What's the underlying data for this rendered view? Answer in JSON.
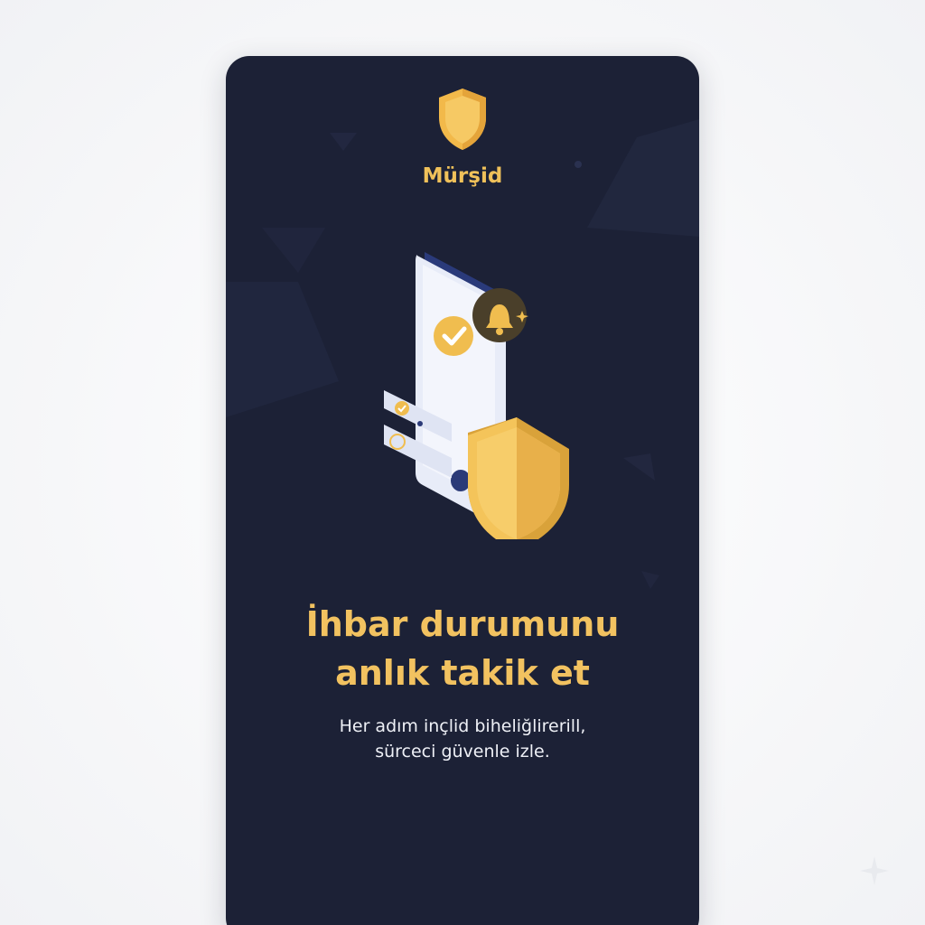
{
  "brand": {
    "name": "Mürşid",
    "icon": "shield-icon",
    "accent_color": "#f0c15a"
  },
  "illustration": {
    "icons": [
      "phone-icon",
      "shield-icon",
      "bell-icon",
      "checkmark-icon"
    ]
  },
  "content": {
    "headline_line1": "İhbar durumunu",
    "headline_line2": "anlık takik et",
    "subtext_line1": "Her adım  inçlid biheliğlirerill,",
    "subtext_line2": "sürceci güvenle izle."
  },
  "colors": {
    "card_background": "#1c2136",
    "headline": "#f2c260",
    "body_text": "#eef0f6"
  }
}
